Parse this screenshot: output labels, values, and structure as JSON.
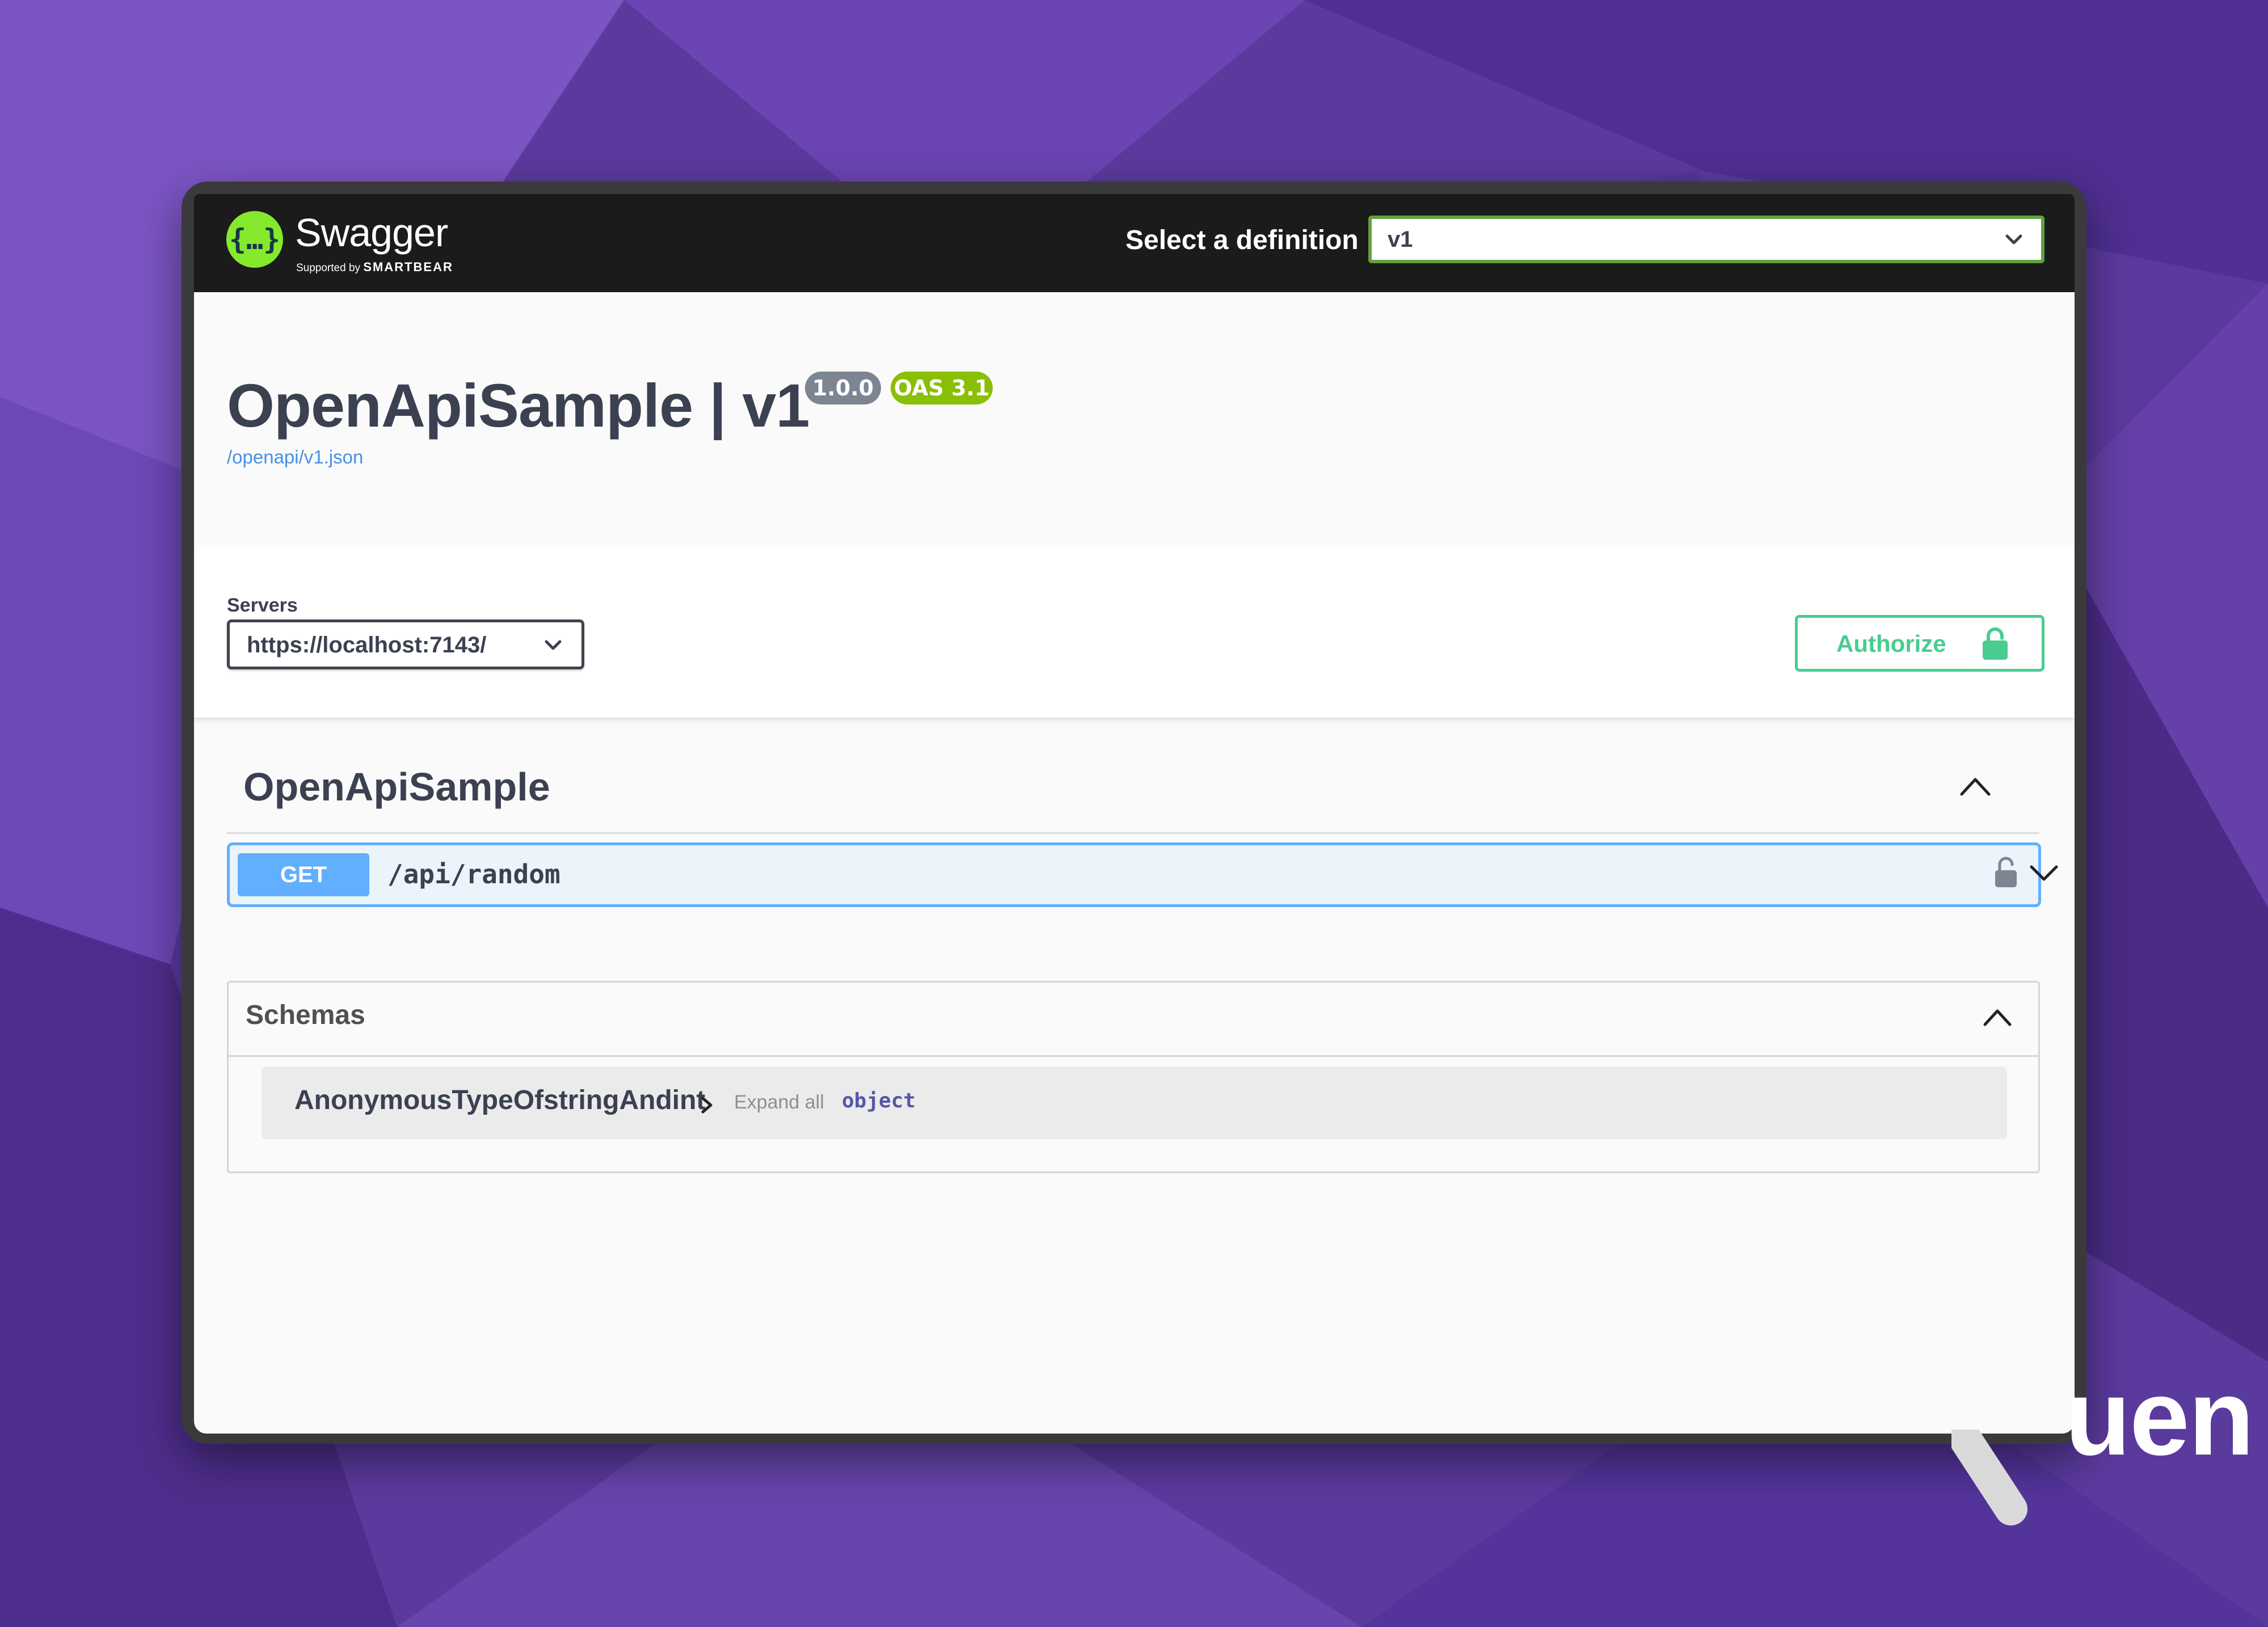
{
  "header": {
    "brand_name": "Swagger",
    "brand_supported_by": "Supported by",
    "brand_company": "SMARTBEAR",
    "definition_label": "Select a definition",
    "definition_value": "v1"
  },
  "info": {
    "title": "OpenApiSample | v1",
    "version_badge": "1.0.0",
    "oas_badge": "OAS 3.1",
    "spec_link": "/openapi/v1.json"
  },
  "servers": {
    "label": "Servers",
    "selected": "https://localhost:7143/"
  },
  "authorize": {
    "label": "Authorize"
  },
  "tag": {
    "name": "OpenApiSample"
  },
  "operations": [
    {
      "method": "GET",
      "path": "/api/random"
    }
  ],
  "schemas": {
    "title": "Schemas",
    "models": [
      {
        "name": "AnonymousTypeOfstringAndint",
        "expand_label": "Expand all",
        "type": "object"
      }
    ]
  },
  "decoration": {
    "partial_text": "uen"
  },
  "colors": {
    "background": "#5b3a9e",
    "topbar": "#1b1b1b",
    "swagger_green": "#85ea2d",
    "select_border": "#62a03f",
    "authorize_green": "#49cc90",
    "get_blue": "#61affe",
    "get_bg": "#ebf3fb",
    "version_badge": "#7d8492",
    "oas_badge": "#89bf04"
  }
}
